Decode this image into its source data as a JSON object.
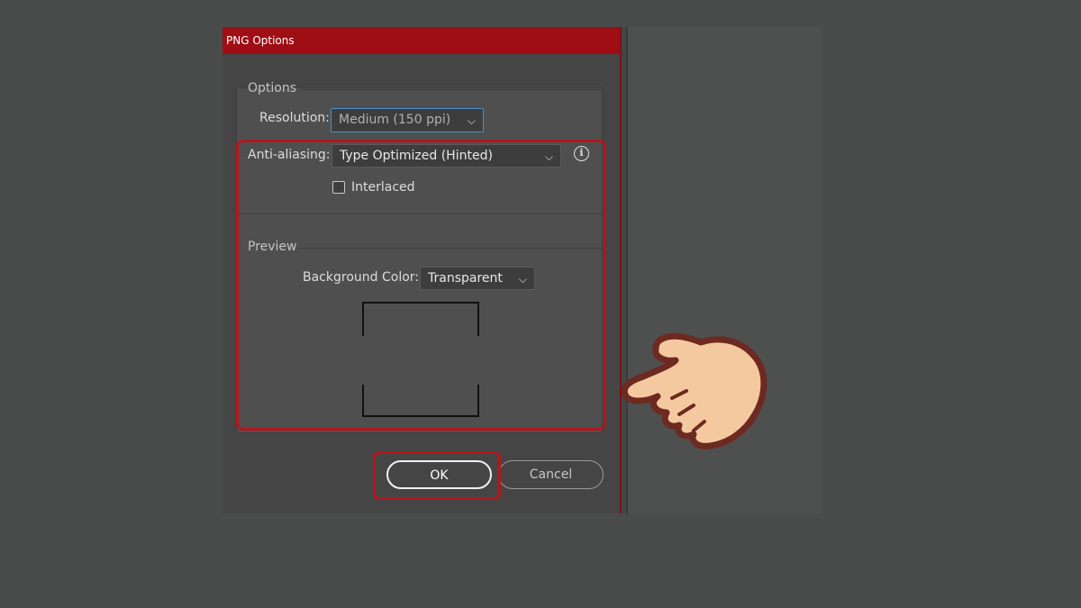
{
  "dialog": {
    "title": "PNG Options",
    "options_section": "Options",
    "resolution_label": "Resolution:",
    "resolution_value": "Medium (150 ppi)",
    "antialiasing_label": "Anti-aliasing:",
    "antialiasing_value": "Type Optimized (Hinted)",
    "interlaced_label": "Interlaced",
    "interlaced_checked": false,
    "preview_section": "Preview",
    "background_color_label": "Background Color:",
    "background_color_value": "Transparent",
    "ok_label": "OK",
    "cancel_label": "Cancel"
  },
  "icons": {
    "info": "info-icon",
    "dropdown": "chevron-down-icon",
    "pointer": "pointing-hand-icon"
  },
  "colors": {
    "titlebar": "#9f0e14",
    "highlight": "#b5161d",
    "dialog_bg": "#454545"
  }
}
